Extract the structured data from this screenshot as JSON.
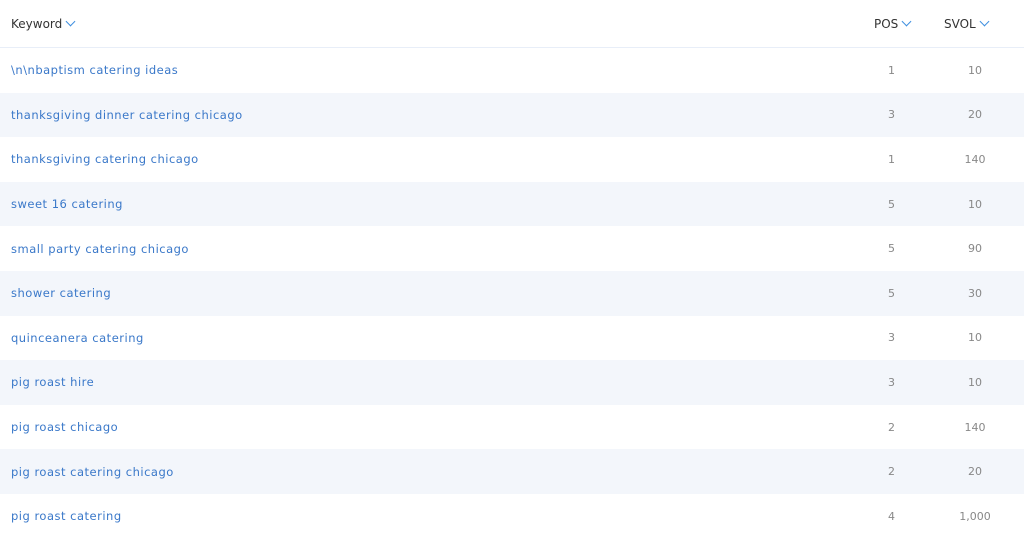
{
  "table": {
    "columns": {
      "keyword": "Keyword",
      "pos": "POS",
      "svol": "SVOL"
    },
    "rows": [
      {
        "keyword": "\\n\\nbaptism catering ideas",
        "pos": "1",
        "svol": "10"
      },
      {
        "keyword": "thanksgiving dinner catering chicago",
        "pos": "3",
        "svol": "20"
      },
      {
        "keyword": "thanksgiving catering chicago",
        "pos": "1",
        "svol": "140"
      },
      {
        "keyword": "sweet 16 catering",
        "pos": "5",
        "svol": "10"
      },
      {
        "keyword": "small party catering chicago",
        "pos": "5",
        "svol": "90"
      },
      {
        "keyword": "shower catering",
        "pos": "5",
        "svol": "30"
      },
      {
        "keyword": "quinceanera catering",
        "pos": "3",
        "svol": "10"
      },
      {
        "keyword": "pig roast hire",
        "pos": "3",
        "svol": "10"
      },
      {
        "keyword": "pig roast chicago",
        "pos": "2",
        "svol": "140"
      },
      {
        "keyword": "pig roast catering chicago",
        "pos": "2",
        "svol": "20"
      },
      {
        "keyword": "pig roast catering",
        "pos": "4",
        "svol": "1,000"
      }
    ]
  },
  "colors": {
    "link": "#3a78c9",
    "accent": "#3f8fe0",
    "row_alt": "#f3f6fb"
  }
}
